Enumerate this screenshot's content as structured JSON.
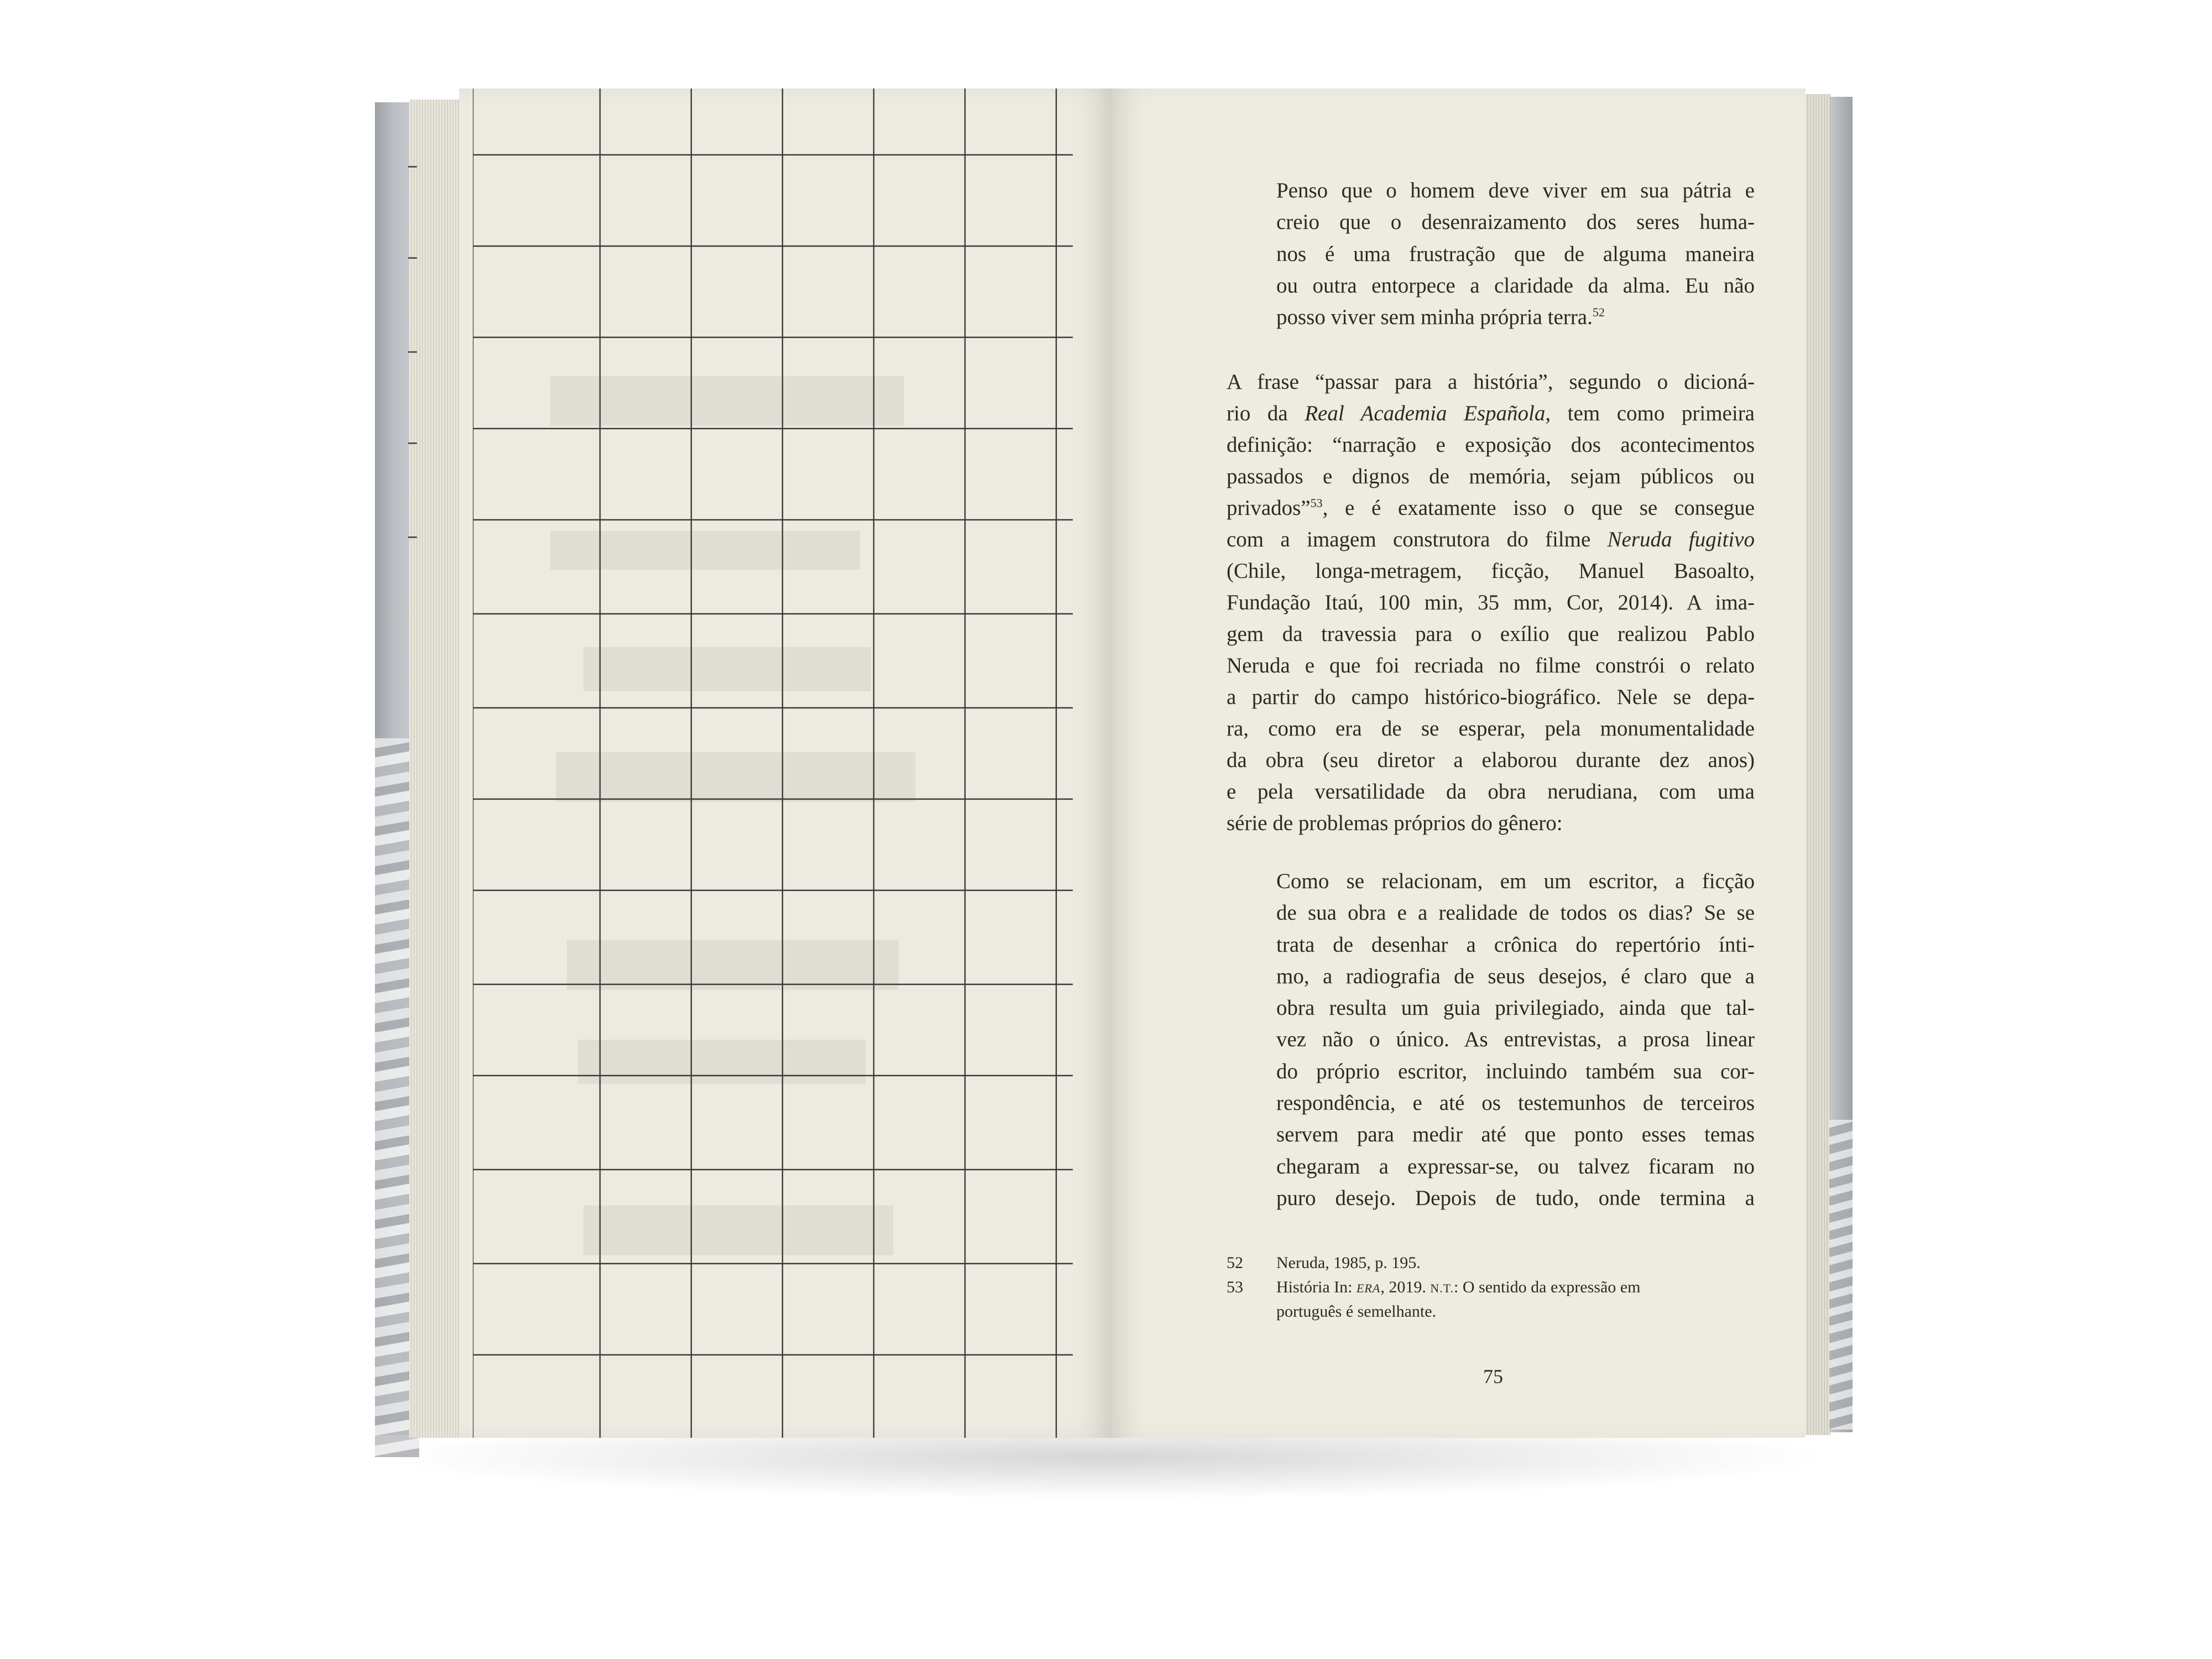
{
  "quote_top": {
    "lines": [
      "Penso que o homem deve viver em sua pátria e",
      "creio que o desenraizamento dos seres huma-",
      "nos é uma frustração que de alguma maneira",
      "ou outra entorpece a claridade da alma. Eu não",
      "posso viver sem minha própria terra."
    ],
    "ref": "52"
  },
  "body": {
    "l1": "A frase “passar para a história”, segundo o dicioná-",
    "l2_pre": "rio da ",
    "l2_italic": "Real Academia Española",
    "l2_post": ", tem como primeira",
    "l3": "definição: “narração e exposição dos acontecimentos",
    "l4": "passados e dignos de memória, sejam públicos ou",
    "l5_pre": "privados”",
    "l5_ref": "53",
    "l5_post": ", e é exatamente isso o que se consegue",
    "l6_pre": "com a imagem construtora do filme ",
    "l6_italic": "Neruda fugitivo",
    "lines_rest": [
      "(Chile, longa-metragem, ficção, Manuel Basoalto,",
      "Fundação Itaú, 100 min, 35 mm, Cor, 2014). A ima-",
      "gem da travessia para o exílio que realizou Pablo",
      "Neruda e que foi recriada no filme constrói o relato",
      "a partir do campo histórico-biográfico. Nele se depa-",
      "ra, como era de se esperar, pela monumentalidade",
      "da obra (seu diretor a elaborou durante dez anos)",
      "e pela versatilidade da obra nerudiana, com uma",
      "série de problemas próprios do gênero:"
    ]
  },
  "quote_bottom": {
    "lines": [
      "Como se relacionam, em um escritor, a ficção",
      "de sua obra e a realidade de todos os dias? Se se",
      "trata de desenhar a crônica do repertório ínti-",
      "mo, a radiografia de seus desejos, é claro que a",
      "obra resulta um guia privilegiado, ainda que tal-",
      "vez não o único. As entrevistas, a prosa linear",
      "do próprio escritor, incluindo também sua cor-",
      "respondência, e até os testemunhos de terceiros",
      "servem para medir até que ponto esses temas",
      "chegaram a expressar-se, ou talvez ficaram no",
      "puro desejo. Depois de tudo, onde termina a"
    ]
  },
  "footnotes": [
    {
      "num": "52",
      "text": "Neruda, 1985, p. 195."
    },
    {
      "num": "53",
      "pre": "História In: ",
      "sc": "ERA",
      "mid": ", 2019. ",
      "sc2": "N.T.",
      "post": ": O sentido da expressão em"
    }
  ],
  "footnote_53_cont": "português é semelhante.",
  "page_number": "75"
}
